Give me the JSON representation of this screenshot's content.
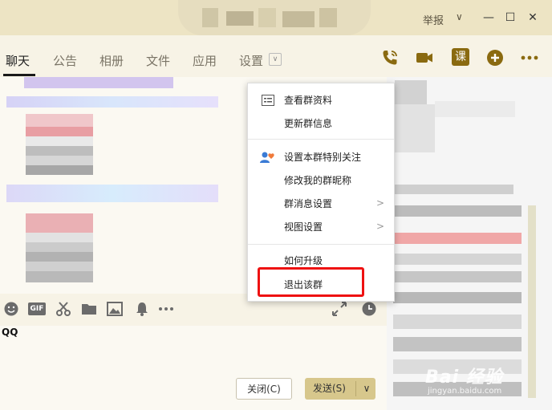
{
  "titlebar": {
    "report_label": "举报",
    "caret": "∨",
    "minimize": "—",
    "maximize": "☐",
    "close": "✕"
  },
  "tabs": [
    {
      "label": "聊天"
    },
    {
      "label": "公告"
    },
    {
      "label": "相册"
    },
    {
      "label": "文件"
    },
    {
      "label": "应用"
    },
    {
      "label": "设置"
    }
  ],
  "settings_caret": "∨",
  "toolbar_icons": [
    "phone-icon",
    "video-icon",
    "lesson-icon",
    "add-icon",
    "more-icon"
  ],
  "lesson_glyph": "课",
  "input_toolbar": [
    "emoji-icon",
    "gif-icon",
    "scissors-icon",
    "folder-icon",
    "image-icon",
    "bell-icon",
    "more-icon",
    "expand-icon",
    "history-icon"
  ],
  "gif_label": "GIF",
  "input": {
    "text": "QQ"
  },
  "buttons": {
    "close": "关闭(C)",
    "send": "发送(S)",
    "send_caret": "∨"
  },
  "menu": {
    "items": [
      {
        "label": "查看群资料"
      },
      {
        "label": "更新群信息"
      },
      {
        "label": "设置本群特别关注"
      },
      {
        "label": "修改我的群昵称"
      },
      {
        "label": "群消息设置"
      },
      {
        "label": "视图设置"
      },
      {
        "label": "如何升级"
      },
      {
        "label": "退出该群"
      }
    ],
    "arrow": ">"
  },
  "watermark": {
    "main": "Bai 经验",
    "sub": "jingyan.baidu.com"
  },
  "colors": {
    "accent": "#8a6a10",
    "highlight": "#ee1111",
    "send_button": "#d7c78c"
  }
}
